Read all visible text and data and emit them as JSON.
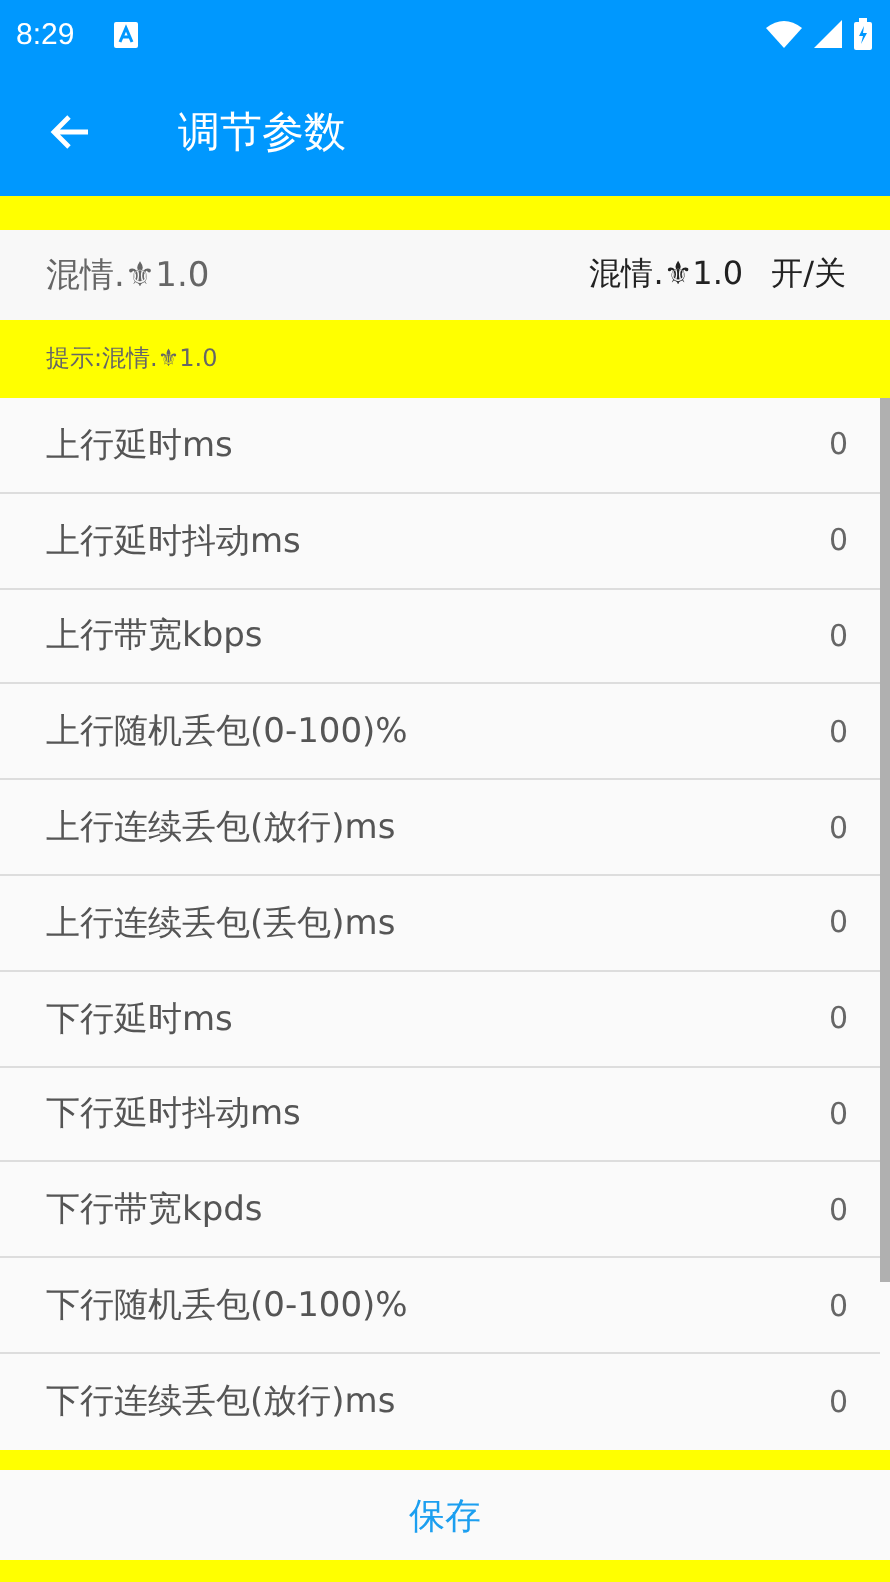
{
  "status_bar": {
    "time": "8:29"
  },
  "app_bar": {
    "title": "调节参数"
  },
  "header": {
    "left": "混情.⚜1.0",
    "right": "混情.⚜1.0",
    "toggle": "开/关"
  },
  "hint": "提示:混情.⚜1.0",
  "params": [
    {
      "label": "上行延时ms",
      "value": "0"
    },
    {
      "label": "上行延时抖动ms",
      "value": "0"
    },
    {
      "label": "上行带宽kbps",
      "value": "0"
    },
    {
      "label": "上行随机丢包(0-100)%",
      "value": "0"
    },
    {
      "label": "上行连续丢包(放行)ms",
      "value": "0"
    },
    {
      "label": "上行连续丢包(丢包)ms",
      "value": "0"
    },
    {
      "label": "下行延时ms",
      "value": "0"
    },
    {
      "label": "下行延时抖动ms",
      "value": "0"
    },
    {
      "label": "下行带宽kpds",
      "value": "0"
    },
    {
      "label": "下行随机丢包(0-100)%",
      "value": "0"
    },
    {
      "label": "下行连续丢包(放行)ms",
      "value": "0"
    }
  ],
  "save_button": "保存"
}
